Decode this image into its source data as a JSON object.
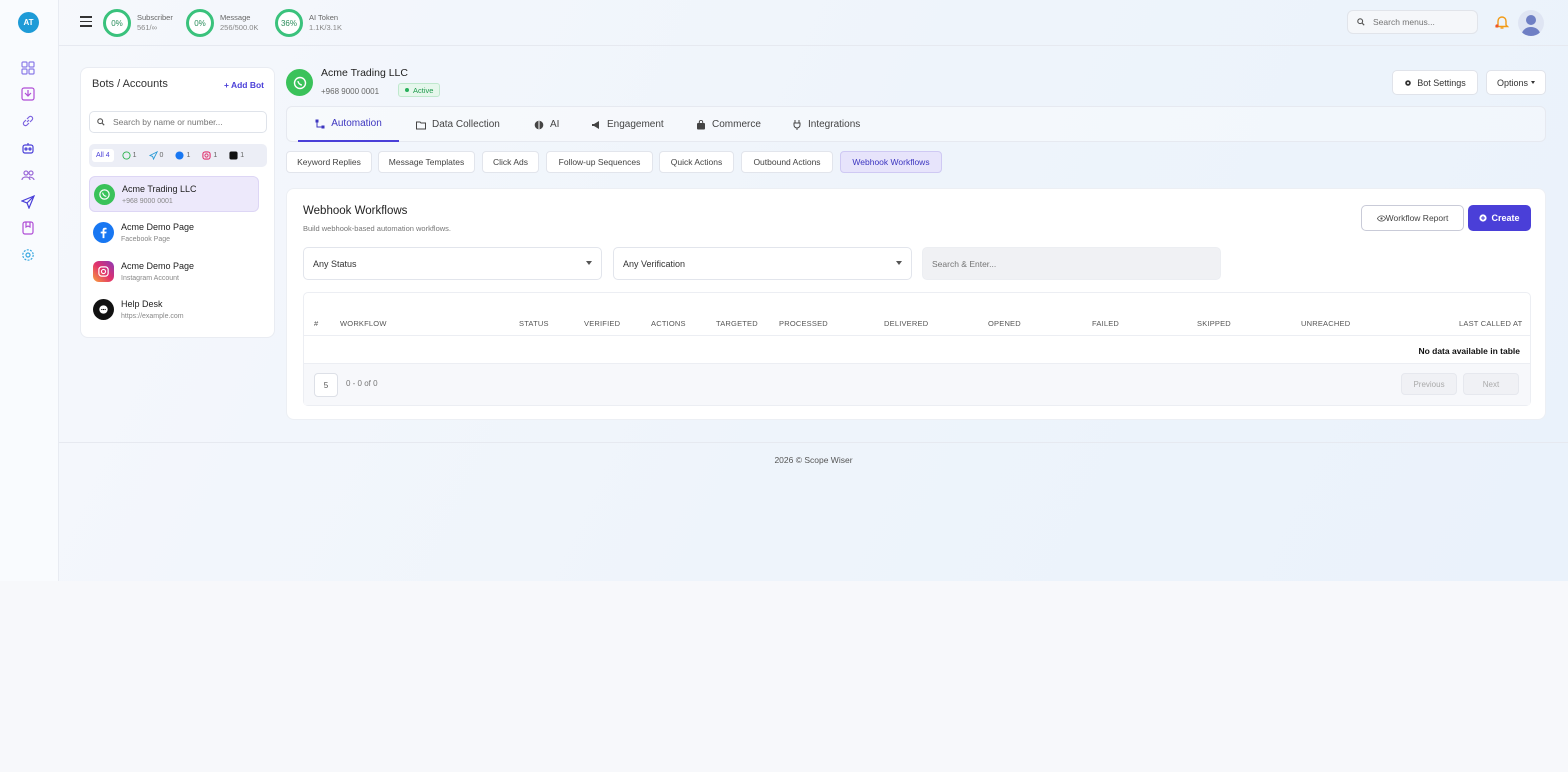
{
  "rail": {
    "avatar": "AT",
    "icons": [
      "dashboard-icon",
      "inbox-icon",
      "link-icon",
      "bot-icon",
      "users-icon",
      "send-icon",
      "bookmark-icon",
      "settings-icon"
    ]
  },
  "topbar": {
    "stats": [
      {
        "percent": "0%",
        "label": "Subscriber",
        "value": "561/∞"
      },
      {
        "percent": "0%",
        "label": "Message",
        "value": "256/500.0K"
      },
      {
        "percent": "36%",
        "label": "AI Token",
        "value": "1.1K/3.1K"
      }
    ],
    "search_placeholder": "Search menus..."
  },
  "accounts": {
    "title": "Bots / Accounts",
    "add_label": "+ Add Bot",
    "search_placeholder": "Search by name or number...",
    "filters": [
      {
        "label": "All 4",
        "icon": ""
      },
      {
        "label": "1",
        "icon": "whatsapp-icon"
      },
      {
        "label": "0",
        "icon": "telegram-icon"
      },
      {
        "label": "1",
        "icon": "facebook-icon"
      },
      {
        "label": "1",
        "icon": "instagram-icon"
      },
      {
        "label": "1",
        "icon": "chat-icon"
      }
    ],
    "items": [
      {
        "name": "Acme Trading LLC",
        "sub": "+968 9000 0001",
        "icon": "whatsapp-icon"
      },
      {
        "name": "Acme Demo Page",
        "sub": "Facebook Page",
        "icon": "facebook-icon"
      },
      {
        "name": "Acme Demo Page",
        "sub": "Instagram Account",
        "icon": "instagram-icon"
      },
      {
        "name": "Help Desk",
        "sub": "https://example.com",
        "icon": "chat-icon"
      }
    ]
  },
  "bot": {
    "name": "Acme Trading LLC",
    "phone": "+968 9000 0001",
    "status": "Active",
    "settings_label": "Bot Settings",
    "options_label": "Options"
  },
  "tabs": [
    "Automation",
    "Data Collection",
    "AI",
    "Engagement",
    "Commerce",
    "Integrations"
  ],
  "subtabs": [
    "Keyword Replies",
    "Message Templates",
    "Click Ads",
    "Follow-up Sequences",
    "Quick Actions",
    "Outbound Actions",
    "Webhook Workflows"
  ],
  "card": {
    "title": "Webhook Workflows",
    "subtitle": "Build webhook-based automation workflows.",
    "report_label": "Workflow Report",
    "create_label": "Create",
    "status_select": "Any Status",
    "verification_select": "Any Verification",
    "search_placeholder": "Search & Enter..."
  },
  "table": {
    "columns": [
      "#",
      "WORKFLOW",
      "STATUS",
      "VERIFIED",
      "ACTIONS",
      "TARGETED",
      "PROCESSED",
      "DELIVERED",
      "OPENED",
      "FAILED",
      "SKIPPED",
      "UNREACHED",
      "LAST CALLED AT"
    ],
    "empty": "No data available in table",
    "page_size": "5",
    "page_info": "0 - 0 of 0",
    "prev_label": "Previous",
    "next_label": "Next"
  },
  "footer": "2026 © Scope Wiser",
  "colors": {
    "accent": "#4a3fd8",
    "ring": "#3ac27c",
    "whatsapp": "#3ac25a"
  }
}
